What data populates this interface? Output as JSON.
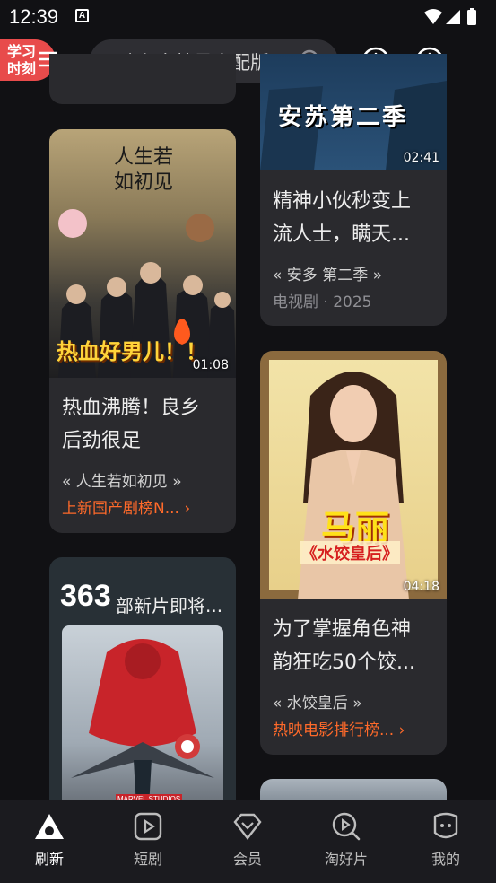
{
  "status_bar": {
    "time": "12:39",
    "notification_icon": "A"
  },
  "header": {
    "study_badge": "学习时刻",
    "search_text": "迪迦奥特曼中配版",
    "icons": [
      "menu-icon",
      "search-icon",
      "download-icon",
      "history-icon"
    ]
  },
  "feed": {
    "left": [
      {
        "duration": "01:08",
        "thumb_caption": "热血好男儿！！",
        "thumb_poster_title": "人生若如初见",
        "title_line1": "热血沸腾！良乡",
        "title_line2": "后劲很足",
        "source": "« 人生若如初见 »",
        "rank": "上新国产剧榜N... ›"
      },
      {
        "promo_count": "363",
        "promo_text": "部新片即将...",
        "studio_mark": "MARVEL STUDIOS"
      }
    ],
    "right": [
      {
        "duration": "02:41",
        "thumb_caption": "安苏第二季",
        "title_line1": "精神小伙秒变上",
        "title_line2": "流人士，瞒天...",
        "source": "« 安多 第二季 »",
        "meta": "电视剧 · 2025"
      },
      {
        "duration": "04:18",
        "thumb_caption_name": "马丽",
        "thumb_caption_sub": "《水饺皇后》",
        "title_line1": "为了掌握角色神",
        "title_line2": "韵狂吃50个饺...",
        "source": "« 水饺皇后 »",
        "rank": "热映电影排行榜... ›"
      }
    ]
  },
  "tabs": [
    {
      "label": "刷新",
      "icon": "refresh-triangle-icon",
      "active": true
    },
    {
      "label": "短剧",
      "icon": "play-square-icon",
      "active": false
    },
    {
      "label": "会员",
      "icon": "vip-diamond-icon",
      "active": false
    },
    {
      "label": "淘好片",
      "icon": "search-play-icon",
      "active": false
    },
    {
      "label": "我的",
      "icon": "profile-face-icon",
      "active": false
    }
  ],
  "colors": {
    "background": "#111114",
    "card": "#2a2a2e",
    "accent": "#ff6a2a",
    "badge": "#e84b4b"
  }
}
